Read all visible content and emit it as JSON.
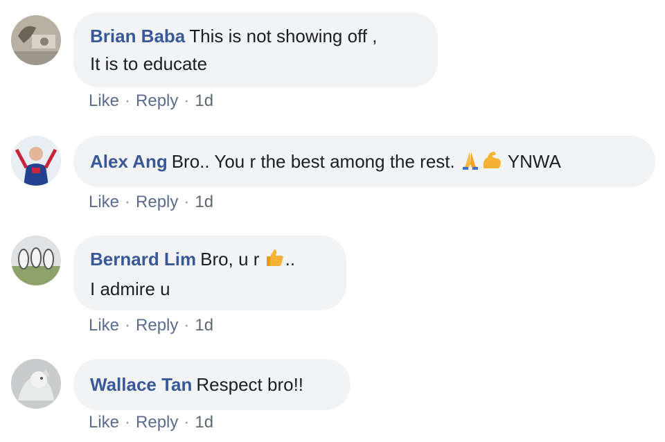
{
  "comments": [
    {
      "author": "Brian Baba",
      "line1": "This is not showing off ,",
      "line2": "It is to educate",
      "like": "Like",
      "reply": "Reply",
      "time": "1d"
    },
    {
      "author": "Alex Ang",
      "text": "Bro.. You r the best among the rest.",
      "suffix": "YNWA",
      "emoji": [
        "pray-icon",
        "flexed-bicep-icon"
      ],
      "like": "Like",
      "reply": "Reply",
      "time": "1d"
    },
    {
      "author": "Bernard Lim",
      "line1": "Bro, u r",
      "line1_suffix": "..",
      "line2": "I admire u",
      "emoji": [
        "thumbs-up-icon"
      ],
      "like": "Like",
      "reply": "Reply",
      "time": "1d"
    },
    {
      "author": "Wallace Tan",
      "text": "Respect bro!!",
      "like": "Like",
      "reply": "Reply",
      "time": "1d"
    }
  ],
  "separator": "·",
  "colors": {
    "author": "#385898",
    "bubble": "#f2f3f5",
    "text": "#1c1e21",
    "action": "#5b6b8c"
  }
}
